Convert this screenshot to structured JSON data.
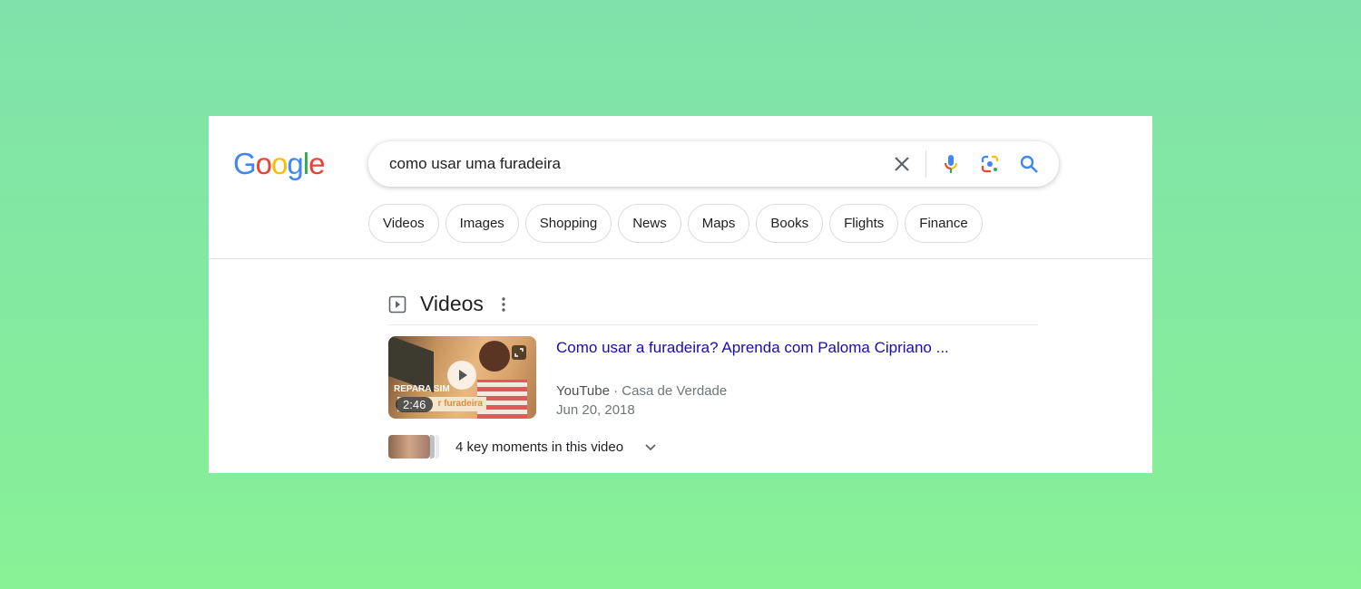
{
  "logo": {
    "text": "Google",
    "colors": [
      "#4285f4",
      "#ea4335",
      "#fbbc05",
      "#4285f4",
      "#34a853",
      "#ea4335"
    ]
  },
  "search": {
    "value": "como usar uma furadeira",
    "icons": [
      "close-icon",
      "microphone-icon",
      "lens-icon",
      "search-icon"
    ]
  },
  "chips": [
    "Videos",
    "Images",
    "Shopping",
    "News",
    "Maps",
    "Books",
    "Flights",
    "Finance"
  ],
  "videos": {
    "heading": "Videos",
    "result": {
      "title": "Como usar a furadeira? Aprenda com Paloma Cipriano ...",
      "source": "YouTube",
      "channel": "Casa de Verdade",
      "date": "Jun 20, 2018",
      "duration": "2:46",
      "thumb_text_1": "REPARA SIM",
      "thumb_text_2": "r furadeira"
    },
    "key_moments": "4 key moments in this video"
  },
  "colors": {
    "link": "#1a0dab",
    "background": "#84ea9e"
  }
}
